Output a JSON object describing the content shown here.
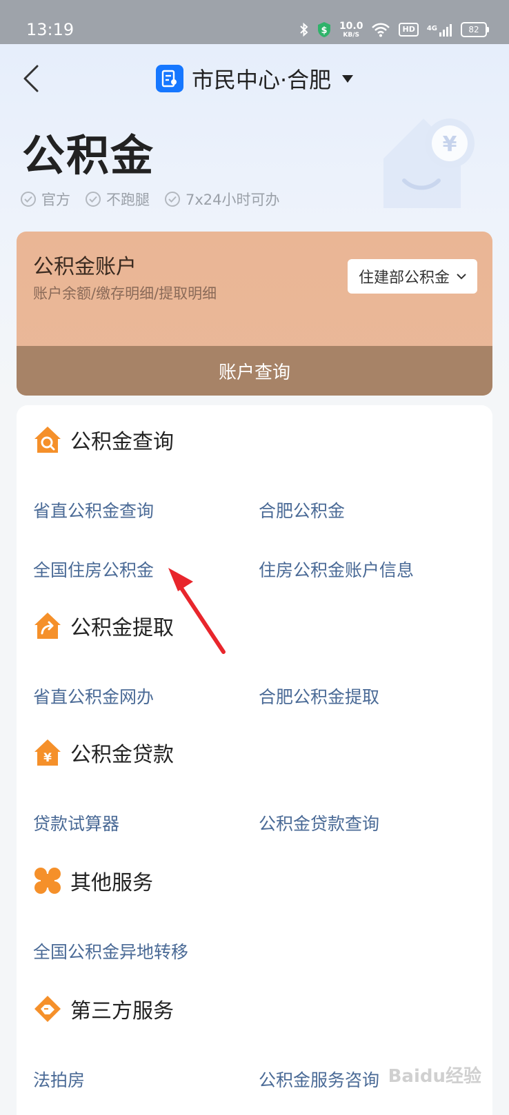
{
  "status_bar": {
    "time": "13:19",
    "net_speed": "10.0",
    "net_unit": "KB/S",
    "hd": "HD",
    "signal_label": "4G",
    "battery": "82"
  },
  "nav": {
    "title": "市民中心·合肥"
  },
  "hero": {
    "title": "公积金",
    "tags": [
      "官方",
      "不跑腿",
      "7x24小时可办"
    ]
  },
  "account": {
    "title": "公积金账户",
    "subtitle": "账户余额/缴存明细/提取明细",
    "selector": "住建部公积金",
    "query_button": "账户查询"
  },
  "sections": [
    {
      "title": "公积金查询",
      "icon": "house-search-icon",
      "links": [
        "省直公积金查询",
        "合肥公积金",
        "全国住房公积金",
        "住房公积金账户信息"
      ]
    },
    {
      "title": "公积金提取",
      "icon": "house-arrow-icon",
      "links": [
        "省直公积金网办",
        "合肥公积金提取"
      ]
    },
    {
      "title": "公积金贷款",
      "icon": "house-yuan-icon",
      "links": [
        "贷款试算器",
        "公积金贷款查询"
      ]
    },
    {
      "title": "其他服务",
      "icon": "four-petal-icon",
      "links": [
        "全国公积金异地转移"
      ]
    },
    {
      "title": "第三方服务",
      "icon": "handshake-icon",
      "links": [
        "法拍房",
        "公积金服务咨询"
      ]
    }
  ],
  "watermark": "Baidu经验",
  "colors": {
    "accent_orange": "#f5902a",
    "link_blue": "#4a6a96",
    "card_peach": "#eab695",
    "card_brown": "#a78367",
    "brand_blue": "#1677ff",
    "annotation_red": "#e8262c"
  }
}
